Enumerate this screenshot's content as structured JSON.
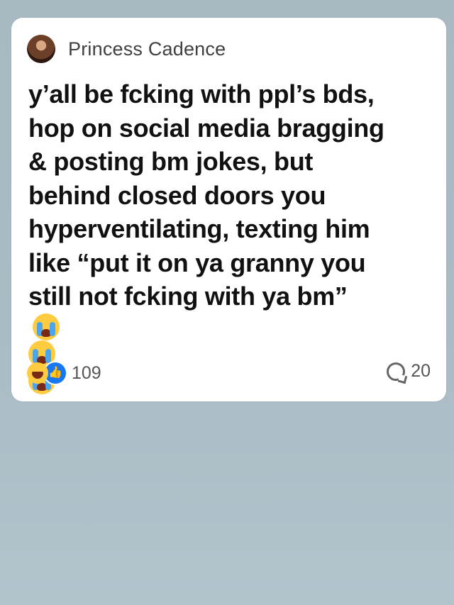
{
  "post": {
    "author": "Princess Cadence",
    "lines": [
      "y’all be fcking with ppl’s bds,",
      "hop on social media bragging",
      "& posting bm jokes, but",
      "behind closed doors you",
      "hyperventilating, texting him",
      "like “put it on ya granny you",
      "still not fcking with ya bm”"
    ],
    "reaction_count": "109",
    "comment_count": "20"
  },
  "icons": {
    "emoji": "loudly-crying-face",
    "reactions": [
      "haha",
      "like"
    ],
    "comment": "speech-bubble"
  }
}
